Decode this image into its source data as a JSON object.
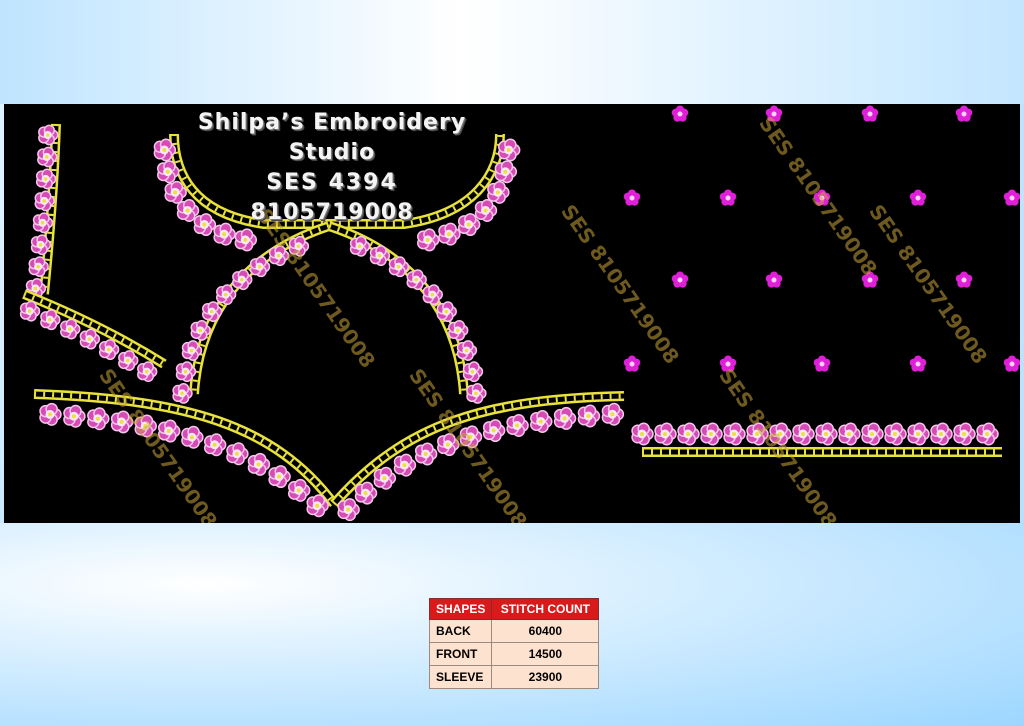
{
  "studio": {
    "name": "Shilpa’s Embroidery Studio",
    "code": "SES 4394",
    "phone": "8105719008"
  },
  "watermark": "SES 8105719008",
  "colors": {
    "background": "#000000",
    "gold": "#e8e23a",
    "petal": "#d64bb5",
    "petal_light": "#f4c6ea",
    "flower_magenta": "#e020d8",
    "table_header": "#d81a1a",
    "table_cell": "#fde3cf"
  },
  "table": {
    "headers": [
      "SHAPES",
      "STITCH COUNT"
    ],
    "rows": [
      {
        "shape": "BACK",
        "count": "60400"
      },
      {
        "shape": "FRONT",
        "count": "14500"
      },
      {
        "shape": "SLEEVE",
        "count": "23900"
      }
    ]
  }
}
